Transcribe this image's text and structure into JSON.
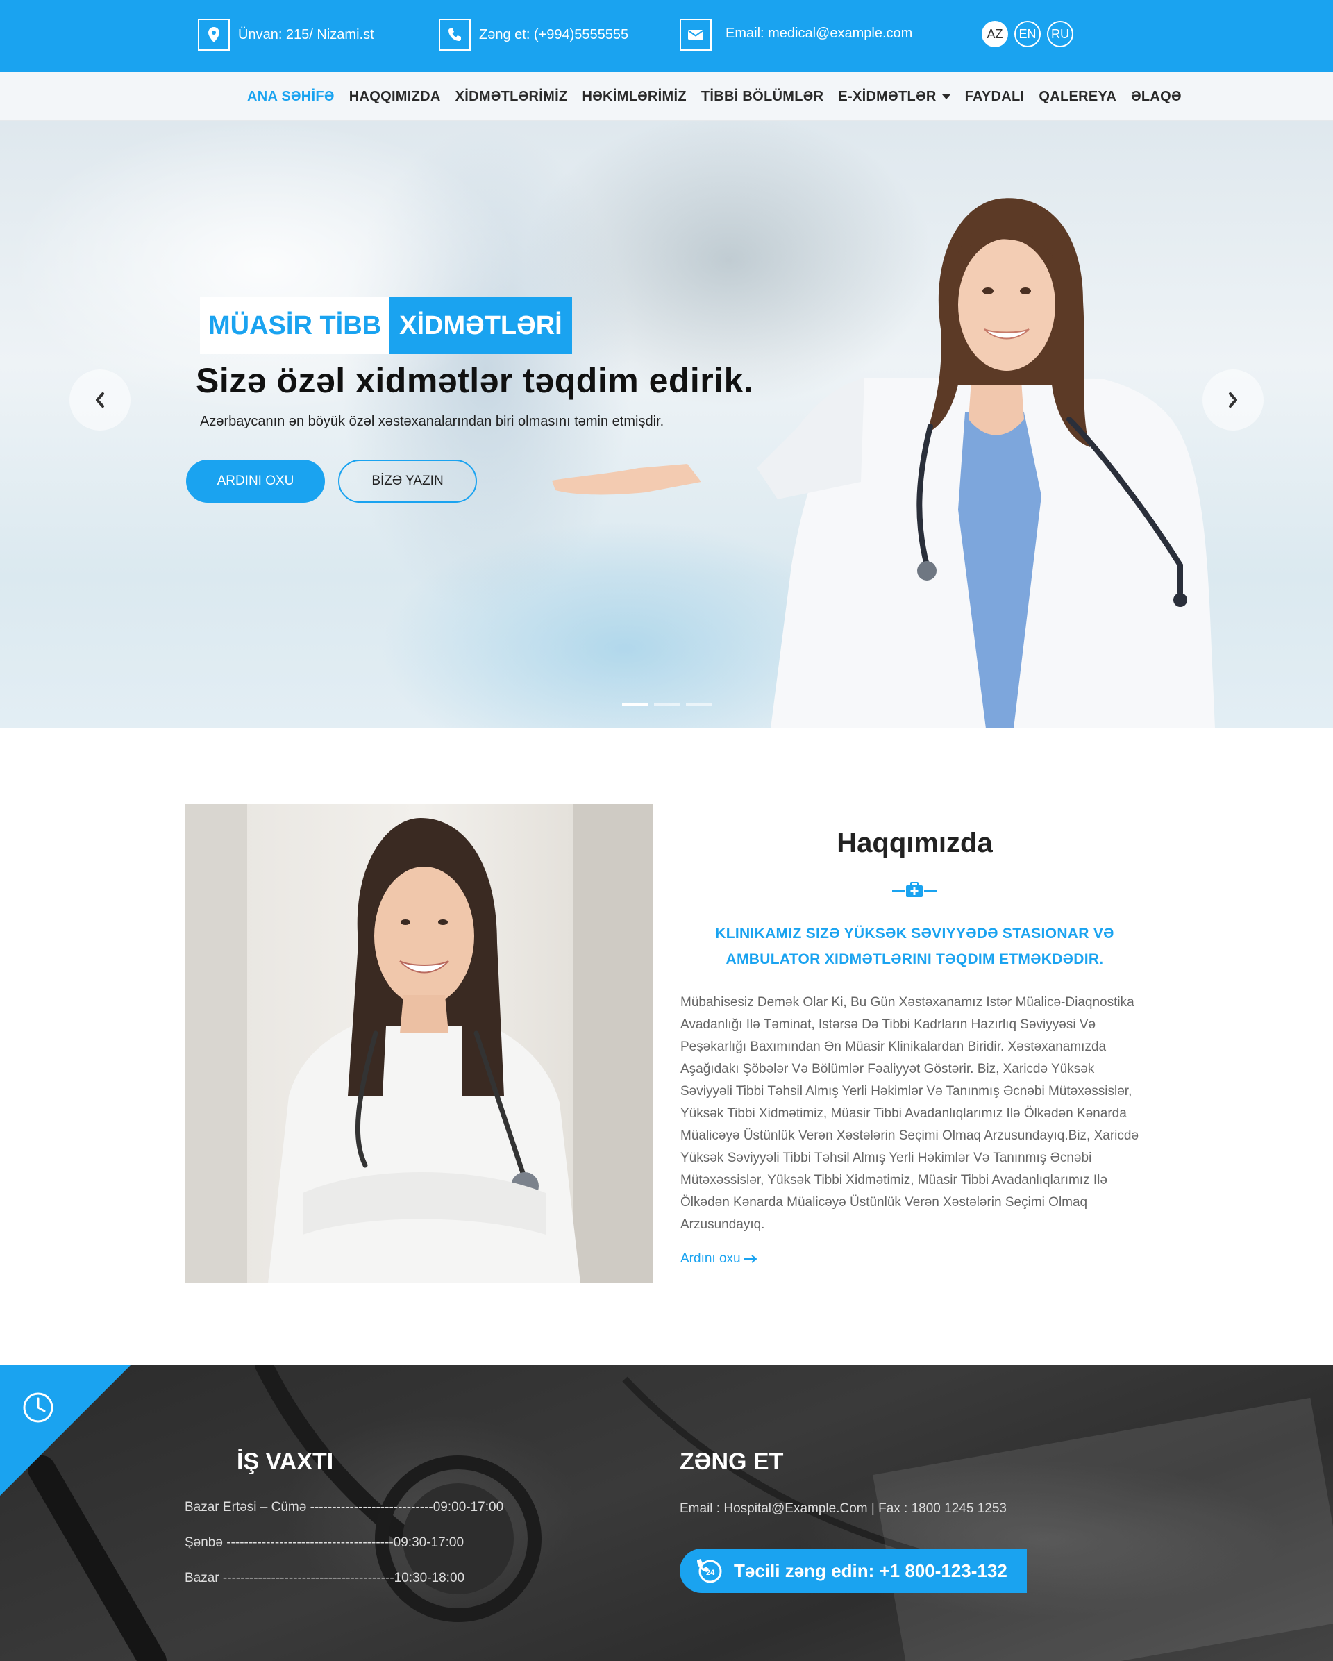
{
  "topbar": {
    "address": "Ünvan: 215/ Nizami.st",
    "phone": "Zəng et: (+994)5555555",
    "email": "Email: medical@example.com",
    "languages": [
      "AZ",
      "EN",
      "RU"
    ],
    "active_language": "AZ",
    "icons": [
      "map-pin-icon",
      "phone-icon",
      "envelope-icon"
    ]
  },
  "nav": {
    "items": [
      "ANA SƏHİFƏ",
      "HAQQIMIZDA",
      "XİDMƏTLƏRİMİZ",
      "HƏKİMLƏRİMİZ",
      "TİBBİ BÖLÜMLƏR",
      "E-XİDMƏTLƏR",
      "FAYDALI",
      "QALEREYA",
      "ƏLAQƏ"
    ],
    "active": "ANA SƏHİFƏ"
  },
  "hero": {
    "badge_part1": "MÜASİR TİBB",
    "badge_part2": "XİDMƏTLƏRİ",
    "title": "Sizə özəl xidmətlər təqdim edirik.",
    "subtitle": "Azərbaycanın ən böyük özəl xəstəxanalarından biri olmasını təmin etmişdir.",
    "primary_button": "ARDINI OXU",
    "secondary_button": "BİZƏ YAZIN",
    "slides": 3,
    "active_slide": 1
  },
  "about": {
    "title": "Haqqımızda",
    "lead": "KLINIKAMIZ SIZƏ YÜKSƏK SƏVIYYƏDƏ STASIONAR VƏ AMBULATOR XIDMƏTLƏRINI TƏQDIM ETMƏKDƏDIR.",
    "text": "Mübahisesiz Demək Olar Ki, Bu Gün Xəstəxanamız Istər Müalicə-Diaqnostika Avadanlığı Ilə Təminat, Istərsə Də Tibbi Kadrların Hazırlıq Səviyyəsi Və Peşəkarlığı Baxımından Ən Müasir Klinikalardan Biridir. Xəstəxanamızda Aşağıdakı Şöbələr Və Bölümlər Fəaliyyət Göstərir. Biz, Xaricdə Yüksək Səviyyəli Tibbi Təhsil Almış Yerli Həkimlər Və Tanınmış Əcnəbi Mütəxəssislər, Yüksək Tibbi Xidmətimiz, Müasir Tibbi Avadanlıqlarımız Ilə Ölkədən Kənarda Müalicəyə Üstünlük Verən Xəstələrin Seçimi Olmaq Arzusundayıq.Biz, Xaricdə Yüksək Səviyyəli Tibbi Təhsil Almış Yerli Həkimlər Və Tanınmış Əcnəbi Mütəxəssislər, Yüksək Tibbi Xidmətimiz, Müasir Tibbi Avadanlıqlarımız Ilə Ölkədən Kənarda Müalicəyə Üstünlük Verən Xəstələrin Seçimi Olmaq Arzusundayıq.",
    "more": "Ardını oxu"
  },
  "hours": {
    "title": "İŞ VAXTI",
    "rows": [
      "Bazar Ertəsi – Cümə ----------------------------09:00-17:00",
      "Şənbə --------------------------------------09:30-17:00",
      "Bazar ---------------------------------------10:30-18:00"
    ]
  },
  "contact": {
    "title": "ZƏNG ET",
    "line": "Email : Hospital@Example.Com | Fax : 1800 1245 1253",
    "call_button": "Təcili zəng edin: +1 800-123-132"
  },
  "colors": {
    "accent": "#1aa3f0",
    "dark": "#2e2e2e",
    "text": "#222222",
    "muted": "#666666"
  }
}
